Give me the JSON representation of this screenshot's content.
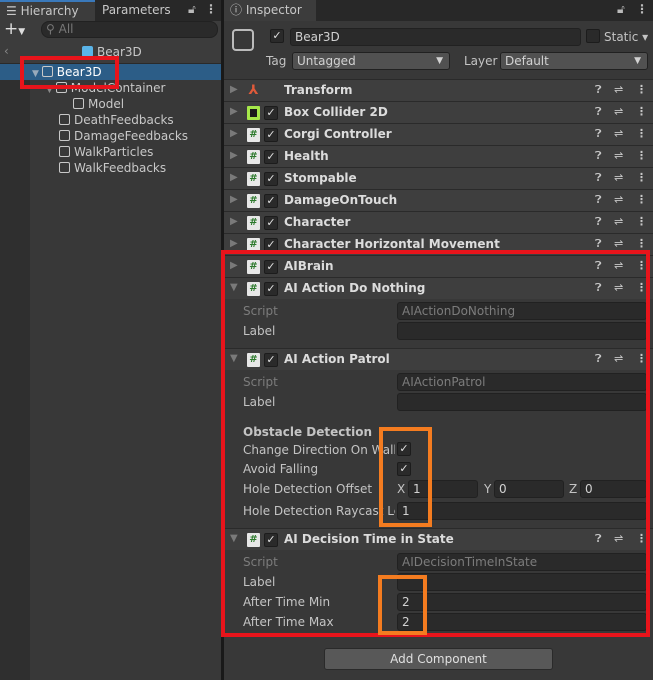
{
  "hierarchy": {
    "tabs": [
      "Hierarchy",
      "Parameters"
    ],
    "search_placeholder": "All",
    "breadcrumb": "Bear3D",
    "items": [
      {
        "label": "Bear3D",
        "selected": true
      },
      {
        "label": "ModelContainer"
      },
      {
        "label": "Model"
      },
      {
        "label": "DeathFeedbacks"
      },
      {
        "label": "DamageFeedbacks"
      },
      {
        "label": "WalkParticles"
      },
      {
        "label": "WalkFeedbacks"
      }
    ]
  },
  "inspector": {
    "tab": "Inspector",
    "object_name": "Bear3D",
    "static_label": "Static",
    "tag_label": "Tag",
    "tag_value": "Untagged",
    "layer_label": "Layer",
    "layer_value": "Default",
    "components": [
      "Transform",
      "Box Collider 2D",
      "Corgi Controller",
      "Health",
      "Stompable",
      "DamageOnTouch",
      "Character",
      "Character Horizontal Movement",
      "AIBrain",
      "AI Action Do Nothing",
      "AI Action Patrol",
      "AI Decision Time in State"
    ],
    "do_nothing": {
      "script_label": "Script",
      "script_value": "AIActionDoNothing",
      "label_label": "Label"
    },
    "patrol": {
      "script_label": "Script",
      "script_value": "AIActionPatrol",
      "label_label": "Label",
      "section": "Obstacle Detection",
      "change_dir": "Change Direction On Wall",
      "avoid": "Avoid Falling",
      "offset": "Hole Detection Offset",
      "x_label": "X",
      "x": "1",
      "y_label": "Y",
      "y": "0",
      "z_label": "Z",
      "z": "0",
      "raycast": "Hole Detection Raycast Length",
      "raycast_value": "1"
    },
    "decision": {
      "script_label": "Script",
      "script_value": "AIDecisionTimeInState",
      "label_label": "Label",
      "min_label": "After Time Min",
      "min": "2",
      "max_label": "After Time Max",
      "max": "2"
    },
    "add_component": "Add Component"
  },
  "colors": {
    "highlight_red": "#e8141b",
    "highlight_orange": "#f47c20",
    "selection": "#2c5d87"
  }
}
